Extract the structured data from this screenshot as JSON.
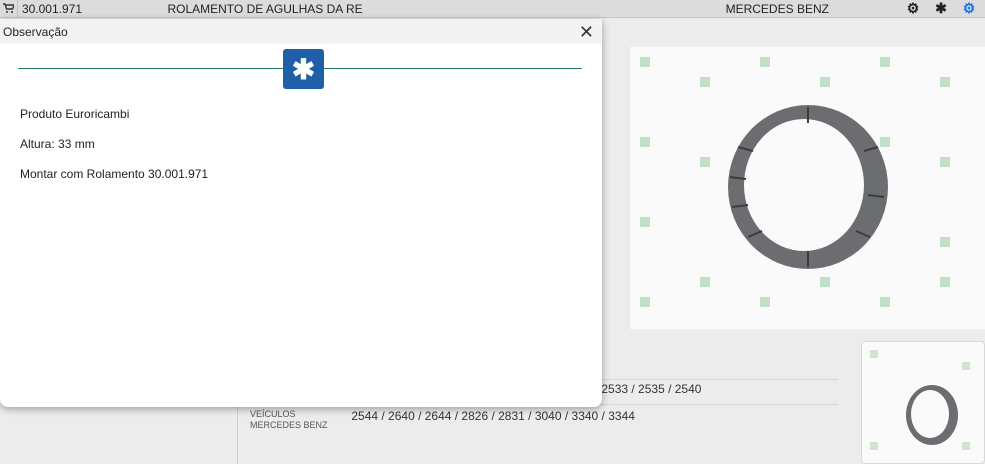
{
  "topbar": {
    "code": "30.001.971",
    "description": "ROLAMENTO DE AGULHAS DA RE",
    "brand": "MERCEDES BENZ",
    "icons": [
      "cart-icon",
      "gear-icon",
      "asterisk-icon",
      "settings-icon"
    ]
  },
  "modal": {
    "title": "Observação",
    "close_label": "✕",
    "lines": [
      "Produto Euroricambi",
      "Altura: 33 mm",
      "Montar com Rolamento 30.001.971"
    ]
  },
  "details": {
    "row1_values": "2533 / 2535 / 2540",
    "row2_label": "VEÍCULOS MERCEDES BENZ",
    "row2_values": "2544 / 2640 / 2644 / 2826 / 2831 / 3040 / 3340 / 3344"
  },
  "colors": {
    "accent": "#1f5fa8",
    "divider": "#1f7a4d",
    "settings_icon": "#1a73e8"
  }
}
